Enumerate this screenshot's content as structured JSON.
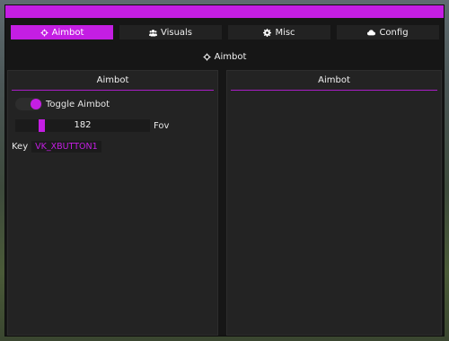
{
  "colors": {
    "accent": "#c41ee3",
    "window_bg": "#161616",
    "panel_bg": "#232323"
  },
  "tabs": [
    {
      "label": "Aimbot",
      "icon": "crosshair-icon",
      "active": true
    },
    {
      "label": "Visuals",
      "icon": "users-icon",
      "active": false
    },
    {
      "label": "Misc",
      "icon": "gear-icon",
      "active": false
    },
    {
      "label": "Config",
      "icon": "cloud-icon",
      "active": false
    }
  ],
  "section_title": {
    "label": "Aimbot",
    "icon": "crosshair-icon"
  },
  "left_panel": {
    "title": "Aimbot",
    "toggle": {
      "label": "Toggle Aimbot",
      "on": true
    },
    "fov_slider": {
      "value": "182",
      "label": "Fov",
      "fraction": 0.2
    },
    "keybind": {
      "label": "Key",
      "value": "VK_XBUTTON1"
    }
  },
  "right_panel": {
    "title": "Aimbot"
  }
}
